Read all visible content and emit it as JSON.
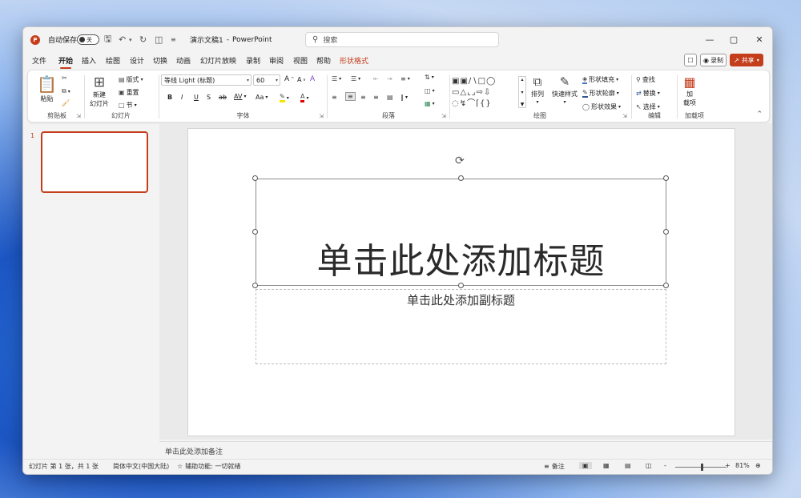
{
  "titlebar": {
    "autosave_label": "自动保存",
    "autosave_state": "关",
    "doc_title": "演示文稿1",
    "app_sep": "-",
    "app_name": "PowerPoint",
    "search_placeholder": "搜索"
  },
  "menu": {
    "tabs": [
      "文件",
      "开始",
      "插入",
      "绘图",
      "设计",
      "切换",
      "动画",
      "幻灯片放映",
      "录制",
      "审阅",
      "视图",
      "帮助",
      "形状格式"
    ],
    "active_tab": "开始",
    "record_label": "录制",
    "share_label": "共享"
  },
  "ribbon": {
    "clipboard": {
      "paste": "粘贴",
      "label": "剪贴板"
    },
    "slides": {
      "new_slide_line1": "新建",
      "new_slide_line2": "幻灯片",
      "layout": "版式",
      "reset": "重置",
      "section": "节",
      "label": "幻灯片"
    },
    "font": {
      "font_name": "等线 Light (标题)",
      "font_size": "60",
      "bold": "B",
      "italic": "I",
      "underline": "U",
      "shadow": "S",
      "strike": "ab",
      "spacing": "AV",
      "case": "Aa",
      "grow": "A",
      "shrink": "A",
      "clear": "A",
      "label": "字体"
    },
    "paragraph": {
      "label": "段落"
    },
    "drawing": {
      "arrange": "排列",
      "quick_styles": "快速样式",
      "shape_fill": "形状填充",
      "shape_outline": "形状轮廓",
      "shape_effects": "形状效果",
      "label": "绘图"
    },
    "editing": {
      "find": "查找",
      "replace": "替换",
      "select": "选择",
      "label": "编辑"
    },
    "addins": {
      "addins_line1": "加",
      "addins_line2": "载项",
      "label": "加载项"
    }
  },
  "thumbnails": {
    "slide_number": "1"
  },
  "slide": {
    "title_placeholder": "单击此处添加标题",
    "subtitle_placeholder": "单击此处添加副标题"
  },
  "notes": {
    "placeholder": "单击此处添加备注"
  },
  "statusbar": {
    "slide_info": "幻灯片 第 1 张，共 1 张",
    "language": "简体中文(中国大陆)",
    "accessibility": "辅助功能: 一切就绪",
    "notes_button": "备注",
    "zoom_minus": "-",
    "zoom_plus": "+",
    "zoom_level": "81%"
  },
  "colors": {
    "accent": "#c43e1c"
  }
}
